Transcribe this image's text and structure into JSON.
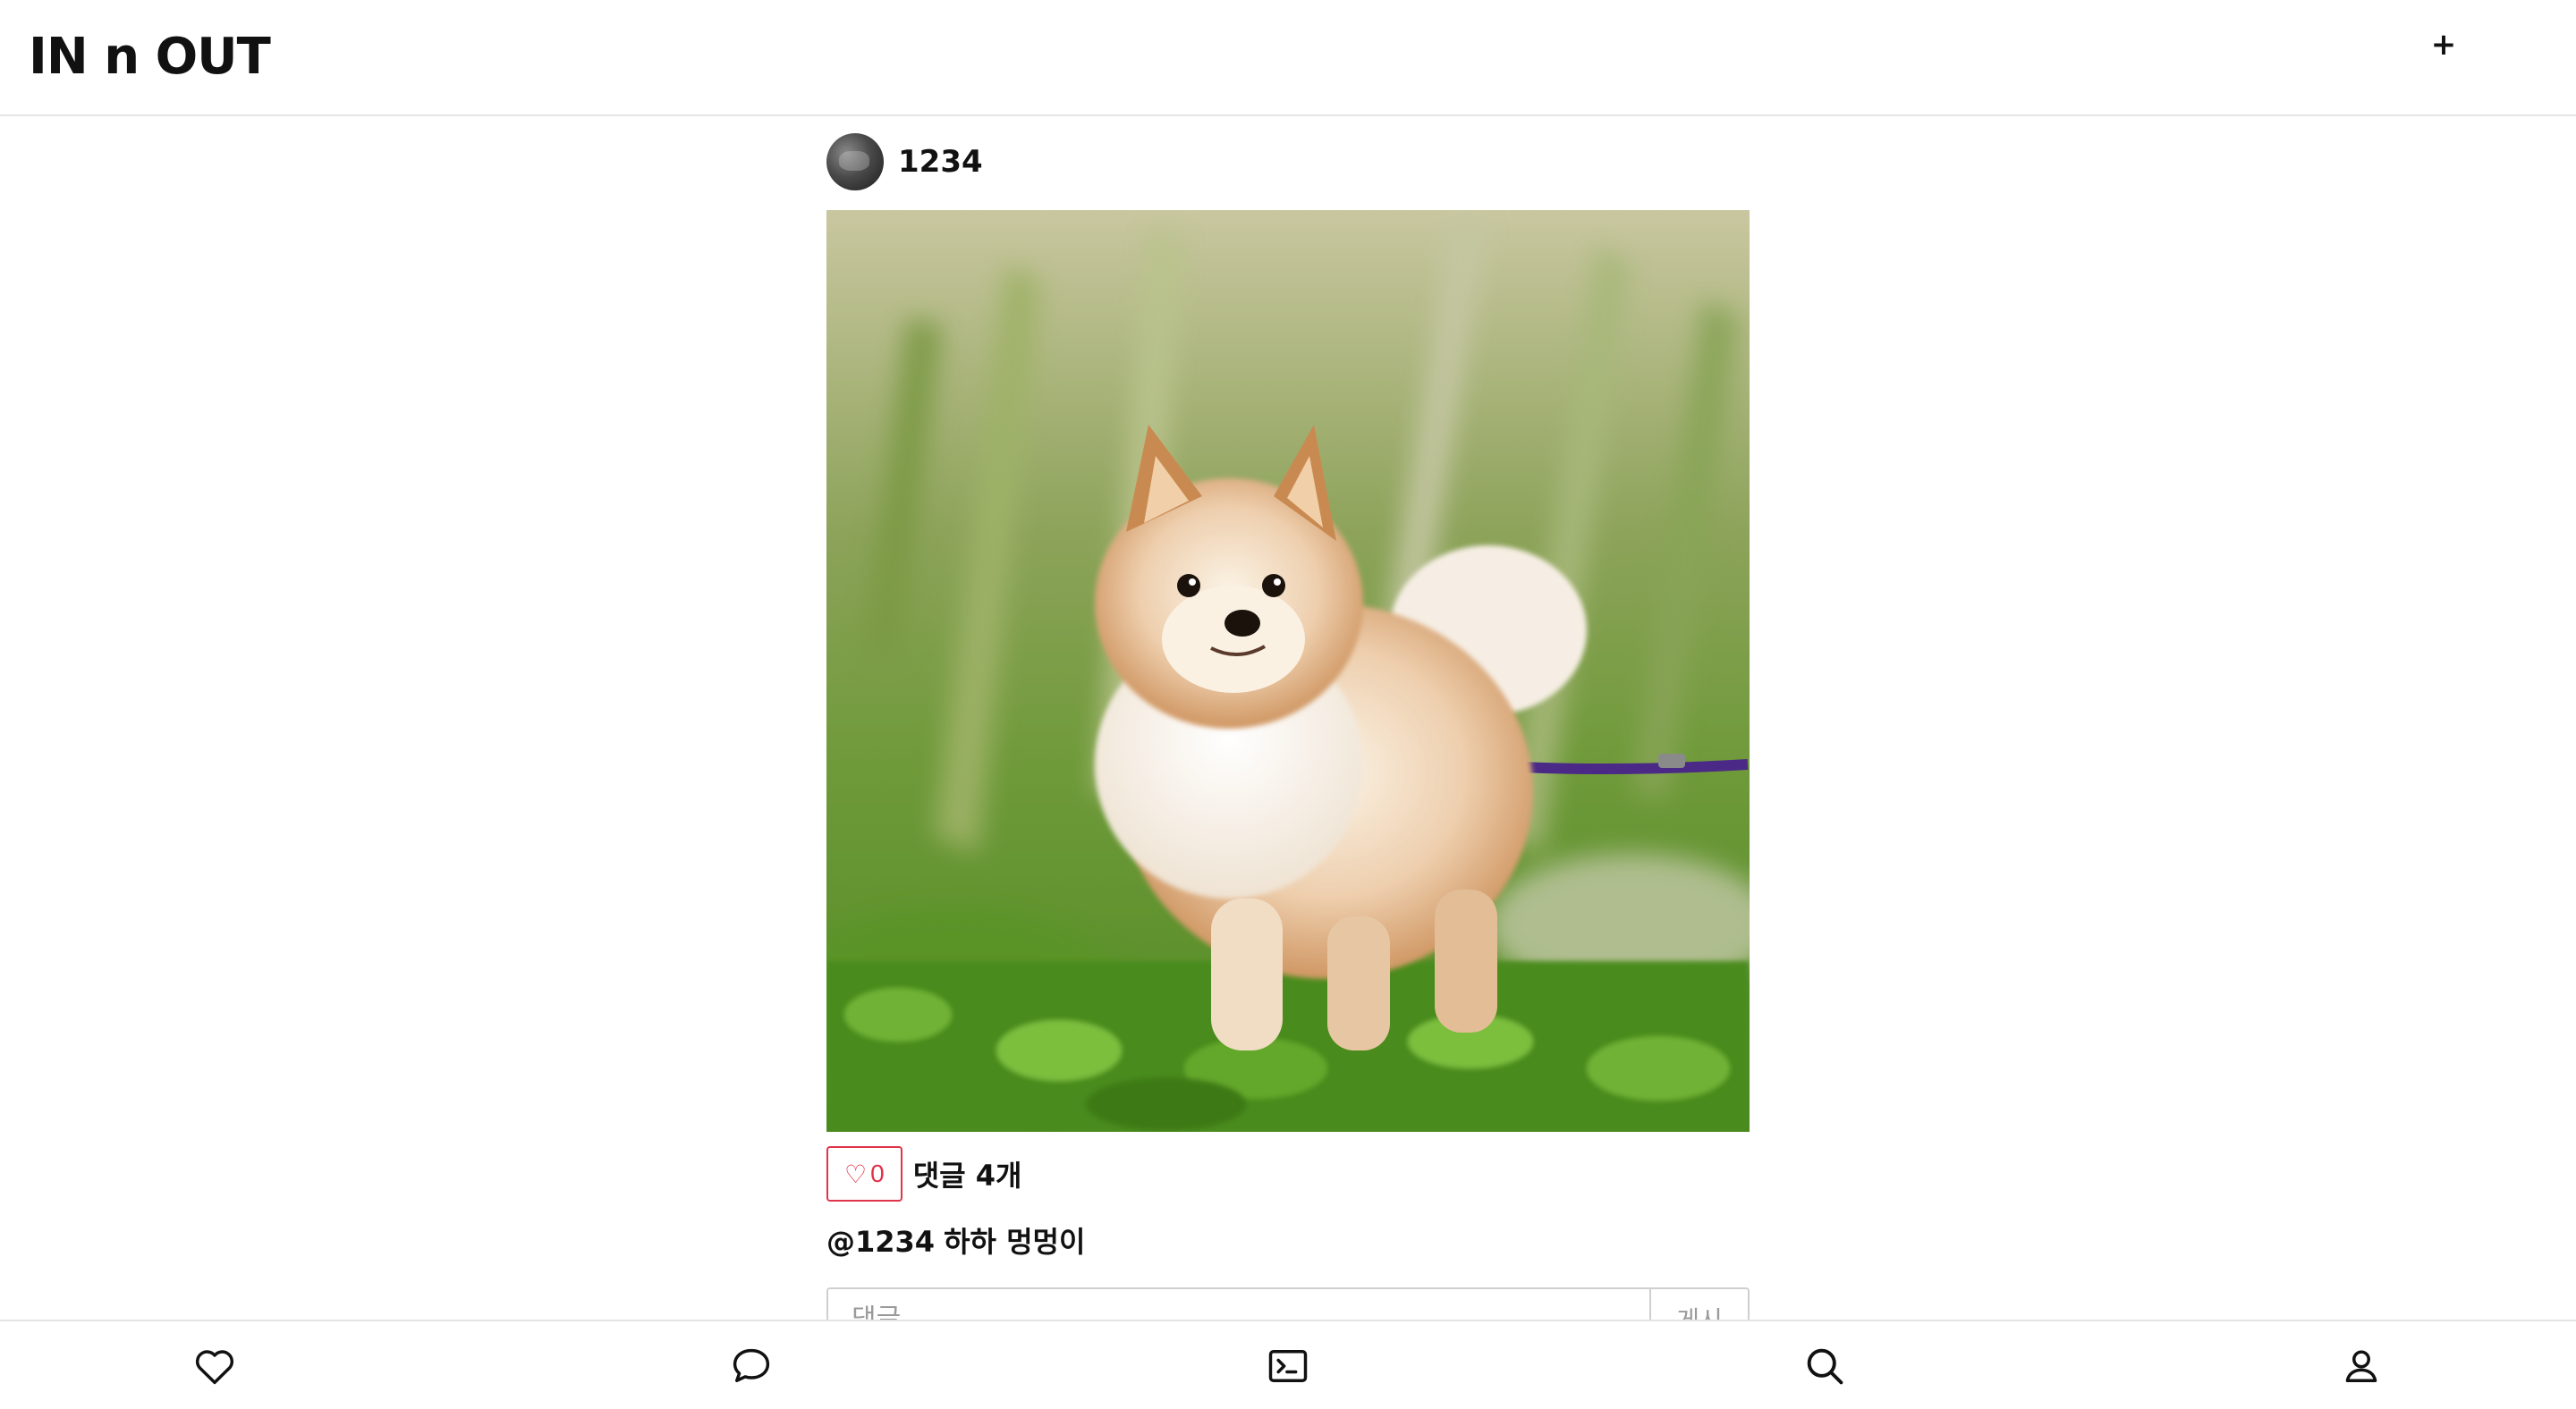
{
  "app": {
    "title": "IN n OUT",
    "add_label": "+"
  },
  "post": {
    "username": "1234",
    "avatar_icon": "user-avatar",
    "image_subject": "dog-photo",
    "like_icon": "♡",
    "like_count": "0",
    "comment_count_label": "댓글 4개",
    "caption_author": "@1234",
    "caption_text": "하하 멍멍이",
    "comment_placeholder": "댓글",
    "submit_label": "게시"
  },
  "bottom_nav": [
    {
      "name": "likes",
      "icon": "heart-icon"
    },
    {
      "name": "chat",
      "icon": "chat-bubble-icon"
    },
    {
      "name": "terminal",
      "icon": "terminal-icon"
    },
    {
      "name": "search",
      "icon": "search-icon"
    },
    {
      "name": "profile",
      "icon": "user-icon"
    }
  ],
  "colors": {
    "accent": "#e0334a",
    "border": "#e4e4e4",
    "text": "#111111"
  }
}
